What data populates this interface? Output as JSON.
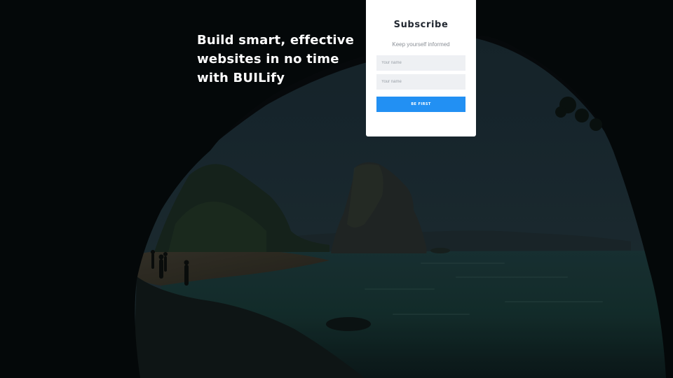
{
  "hero": {
    "headline": "Build smart, effective websites in no time with BUILify"
  },
  "subscribe": {
    "title": "Subscribe",
    "subtitle": "Keep yourself informed",
    "fields": [
      {
        "placeholder": "Your name"
      },
      {
        "placeholder": "Your name"
      }
    ],
    "button_label": "BE FIRST"
  },
  "colors": {
    "accent": "#2290f3",
    "overlay": "#070b0d",
    "card": "#ffffff"
  }
}
